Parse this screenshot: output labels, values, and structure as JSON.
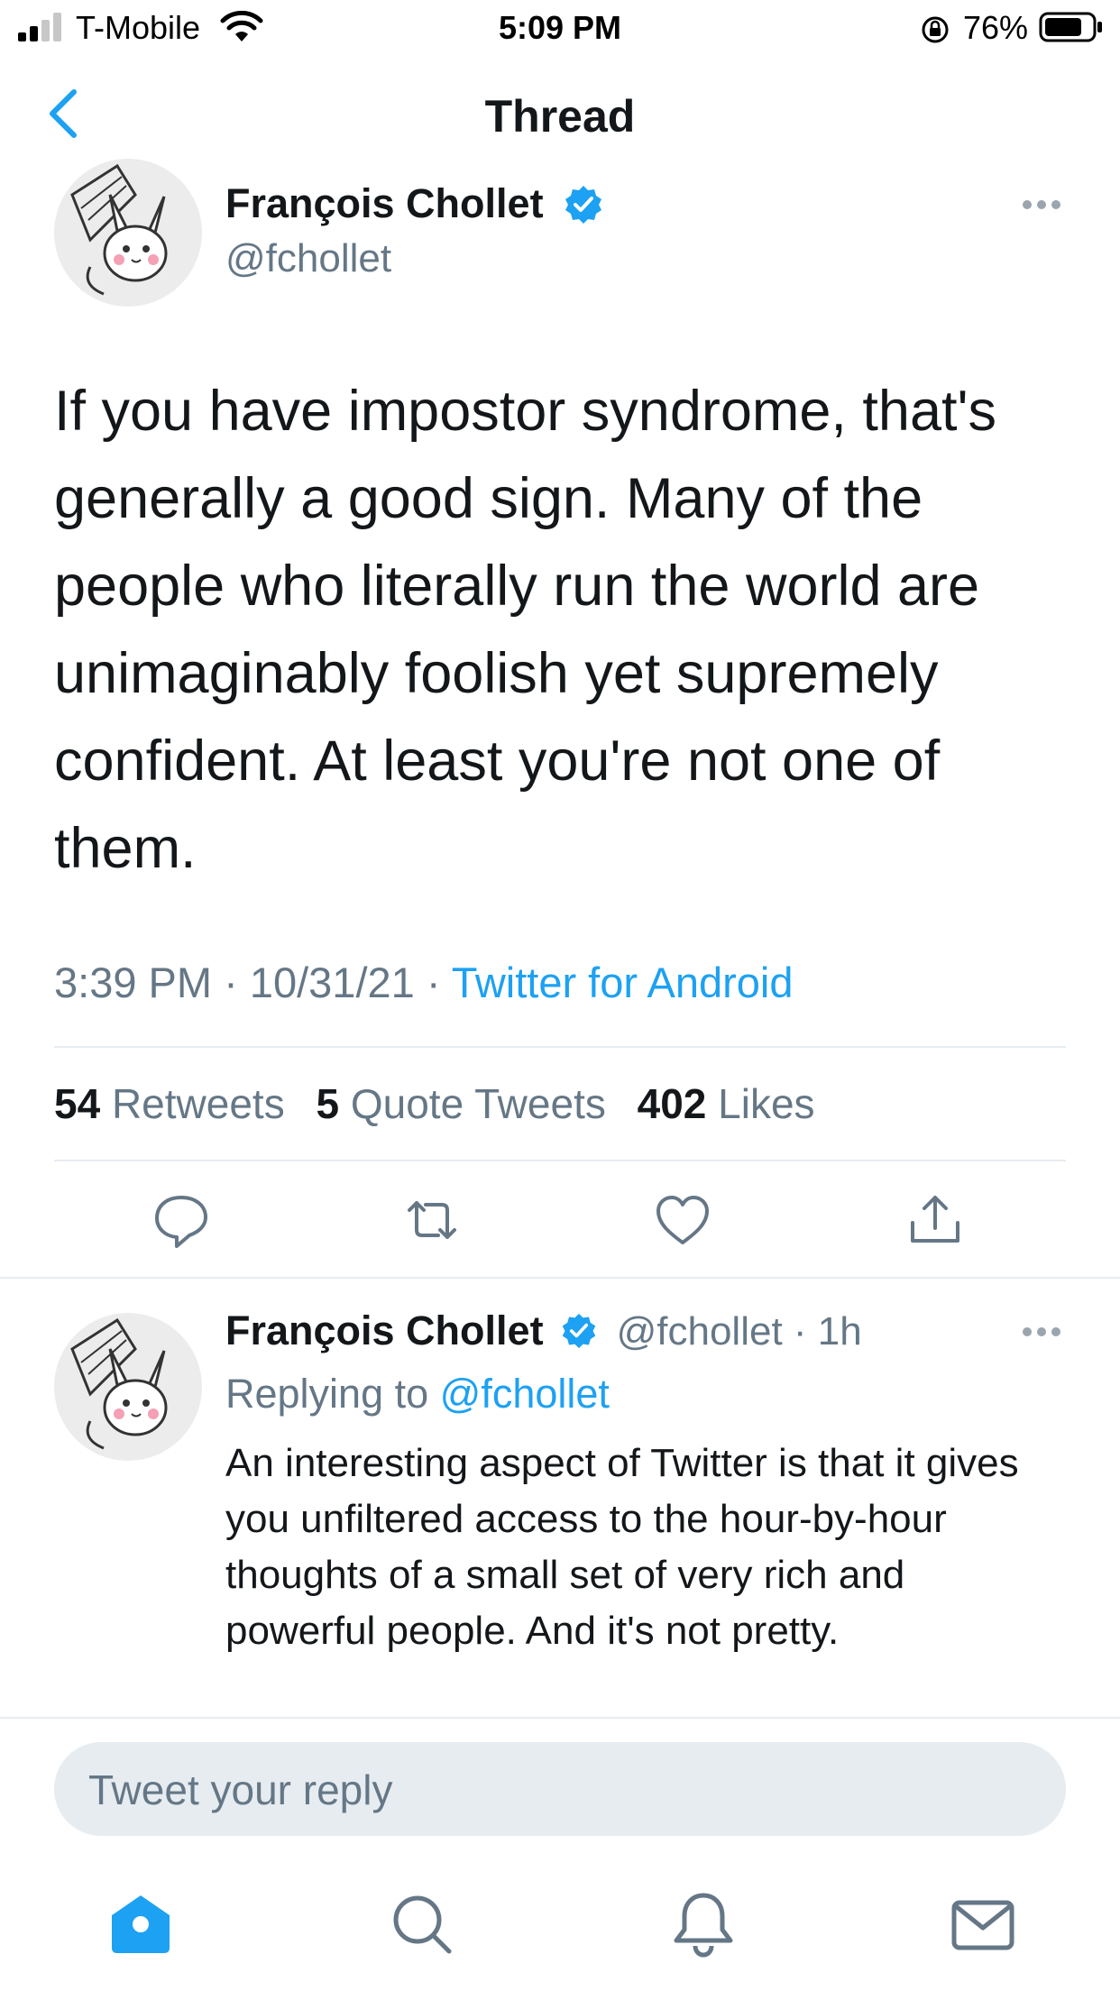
{
  "status_bar": {
    "carrier": "T-Mobile",
    "time": "5:09 PM",
    "battery": "76%"
  },
  "header": {
    "title": "Thread"
  },
  "main_tweet": {
    "author_name": "François Chollet",
    "handle": "@fchollet",
    "text": "If you have impostor syndrome, that's generally a good sign. Many of the people who literally run the world are unimaginably foolish yet supremely confident. At least you're not one of them.",
    "time": "3:39 PM",
    "date": "10/31/21",
    "source": "Twitter for Android",
    "stats": {
      "retweets_count": "54",
      "retweets_label": "Retweets",
      "quotes_count": "5",
      "quotes_label": "Quote Tweets",
      "likes_count": "402",
      "likes_label": "Likes"
    }
  },
  "reply_tweet": {
    "author_name": "François Chollet",
    "handle": "@fchollet",
    "age": "1h",
    "replying_label": "Replying to",
    "replying_to": "@fchollet",
    "text": "An interesting aspect of Twitter is that it gives you unfiltered access to the hour-by-hour thoughts of a small set of very rich and powerful people. And it's not pretty."
  },
  "composer": {
    "placeholder": "Tweet your reply"
  },
  "colors": {
    "accent": "#1da1f2",
    "text": "#14171a",
    "secondary": "#657786",
    "divider": "#e6ecf0"
  },
  "icons": [
    "signal-icon",
    "wifi-icon",
    "orientation-lock-icon",
    "battery-icon",
    "back-chevron-icon",
    "verified-badge-icon",
    "more-icon",
    "reply-icon",
    "retweet-icon",
    "like-icon",
    "share-icon",
    "home-icon",
    "search-icon",
    "notifications-icon",
    "messages-icon"
  ]
}
